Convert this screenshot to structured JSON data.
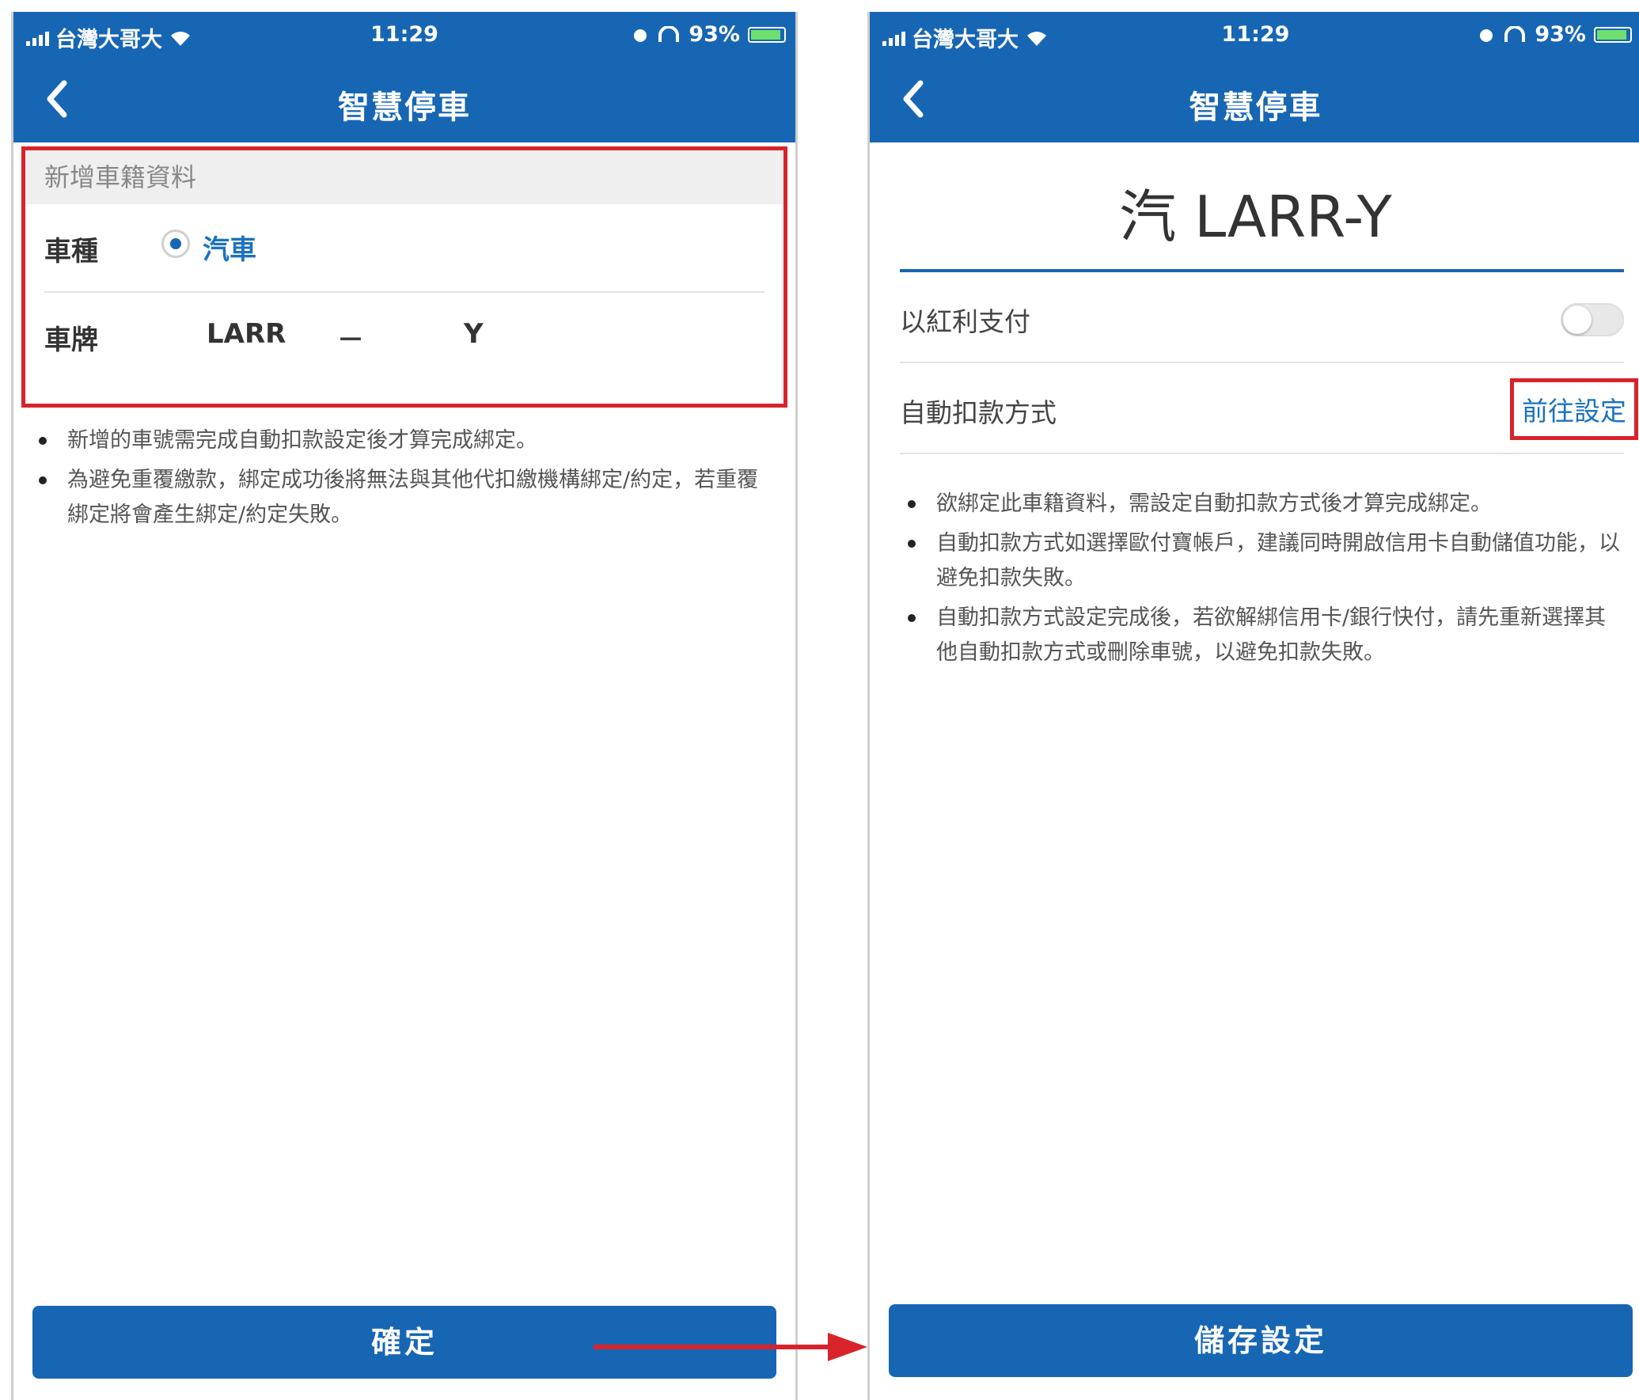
{
  "status_bar": {
    "carrier": "台灣大哥大",
    "time": "11:29",
    "battery": "93%",
    "battery_level": 0.93
  },
  "nav": {
    "title": "智慧停車"
  },
  "left_screen": {
    "section_header": "新增車籍資料",
    "vehicle_type_label": "車種",
    "vehicle_type_value": "汽車",
    "plate_label": "車牌",
    "plate_prefix": "LARR",
    "plate_separator": "－",
    "plate_suffix": "Y",
    "notes": [
      "新增的車號需完成自動扣款設定後才算完成綁定。",
      "為避免重覆繳款，綁定成功後將無法與其他代扣繳機構綁定/約定，若重覆綁定將會產生綁定/約定失敗。"
    ],
    "confirm_button": "確定"
  },
  "right_screen": {
    "plate_title": "汽 LARR-Y",
    "bonus_pay_label": "以紅利支付",
    "bonus_pay_enabled": false,
    "autopay_label": "自動扣款方式",
    "autopay_link": "前往設定",
    "notes": [
      "欲綁定此車籍資料，需設定自動扣款方式後才算完成綁定。",
      "自動扣款方式如選擇歐付寶帳戶，建議同時開啟信用卡自動儲值功能，以避免扣款失敗。",
      "自動扣款方式設定完成後，若欲解綁信用卡/銀行快付，請先重新選擇其他自動扣款方式或刪除車號，以避免扣款失敗。"
    ],
    "save_button": "儲存設定"
  },
  "colors": {
    "brand_blue": "#1766b4",
    "highlight_red": "#d8232a",
    "link_blue": "#1a72c0"
  }
}
